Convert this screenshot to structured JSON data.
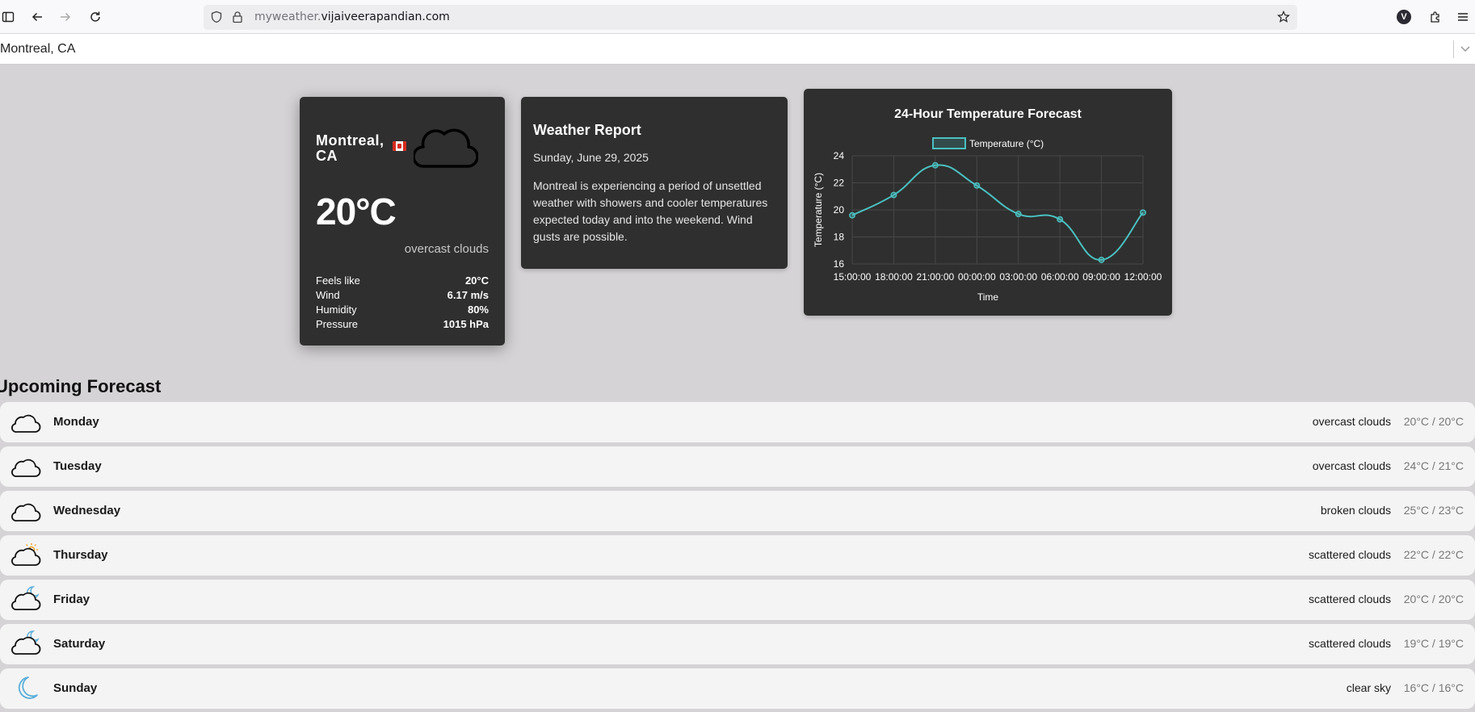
{
  "browser": {
    "url_dim": "myweather.",
    "url_domain": "vijaiveerapandian.com",
    "profile_initial": "V"
  },
  "location_select": {
    "value": "Montreal, CA"
  },
  "current": {
    "city_line1": "Montreal,",
    "city_line2": "CA",
    "temperature": "20°C",
    "description": "overcast clouds",
    "icon": "cloud-icon",
    "stats": [
      {
        "label": "Feels like",
        "value": "20°C"
      },
      {
        "label": "Wind",
        "value": "6.17 m/s"
      },
      {
        "label": "Humidity",
        "value": "80%"
      },
      {
        "label": "Pressure",
        "value": "1015 hPa"
      }
    ]
  },
  "report": {
    "title": "Weather Report",
    "date": "Sunday, June 29, 2025",
    "body": "Montreal is experiencing a period of unsettled weather with showers and cooler temperatures expected today and into the weekend. Wind gusts are possible."
  },
  "chart_data": {
    "type": "line",
    "title": "24-Hour Temperature Forecast",
    "xlabel": "Time",
    "ylabel": "Temperature (°C)",
    "categories": [
      "15:00:00",
      "18:00:00",
      "21:00:00",
      "00:00:00",
      "03:00:00",
      "06:00:00",
      "09:00:00",
      "12:00:00"
    ],
    "series": [
      {
        "name": "Temperature (°C)",
        "values": [
          19.6,
          21.1,
          23.3,
          21.8,
          19.7,
          19.3,
          16.3,
          19.8
        ],
        "color": "#4bc0c0"
      }
    ],
    "ylim": [
      16,
      24
    ],
    "yticks": [
      16,
      18,
      20,
      22,
      24
    ],
    "grid": true,
    "legend": "top-center"
  },
  "upcoming": {
    "title": "Upcoming Forecast",
    "days": [
      {
        "day": "Monday",
        "condition": "overcast clouds",
        "range": "20°C / 20°C",
        "icon": "cloud-icon"
      },
      {
        "day": "Tuesday",
        "condition": "overcast clouds",
        "range": "24°C / 21°C",
        "icon": "cloud-icon"
      },
      {
        "day": "Wednesday",
        "condition": "broken clouds",
        "range": "25°C / 23°C",
        "icon": "cloud-icon"
      },
      {
        "day": "Thursday",
        "condition": "scattered clouds",
        "range": "22°C / 22°C",
        "icon": "cloud-sun-icon"
      },
      {
        "day": "Friday",
        "condition": "scattered clouds",
        "range": "20°C / 20°C",
        "icon": "cloud-moon-icon"
      },
      {
        "day": "Saturday",
        "condition": "scattered clouds",
        "range": "19°C / 19°C",
        "icon": "cloud-moon-icon"
      },
      {
        "day": "Sunday",
        "condition": "clear sky",
        "range": "16°C / 16°C",
        "icon": "moon-icon"
      }
    ]
  }
}
